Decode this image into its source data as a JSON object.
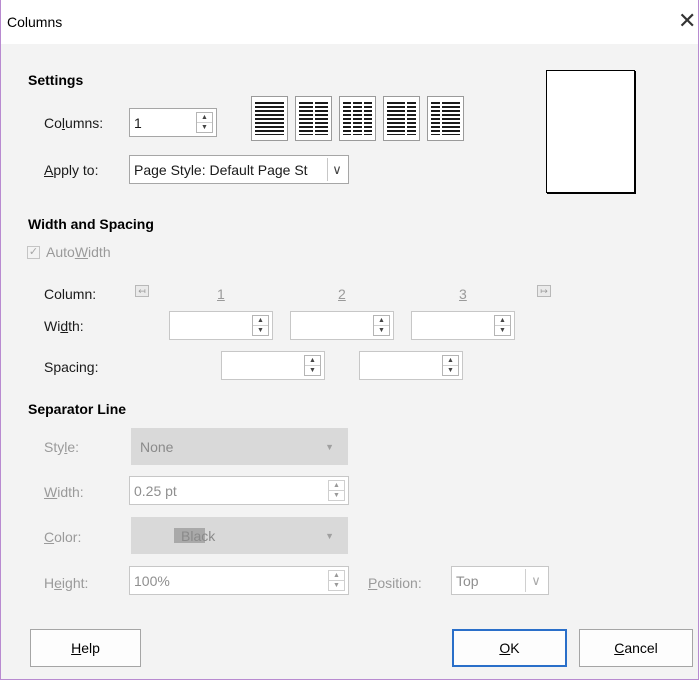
{
  "dialog": {
    "title": "Columns",
    "close_glyph": "✕"
  },
  "settings": {
    "heading": "Settings",
    "columns_label_pre": "Co",
    "columns_label_ul": "l",
    "columns_label_post": "umns:",
    "columns_value": "1",
    "apply_label_ul": "A",
    "apply_label_post": "pply to:",
    "apply_value": "Page Style: Default Page St",
    "presets": [
      "1 column",
      "2 columns equal",
      "3 columns equal",
      "2 columns left larger",
      "2 columns right larger"
    ]
  },
  "width_spacing": {
    "heading": "Width and Spacing",
    "autowidth_pre": "Auto",
    "autowidth_ul": "W",
    "autowidth_post": "idth",
    "autowidth_checked": true,
    "column_label": "Column:",
    "col1": "1",
    "col2": "2",
    "col3": "3",
    "width_label_pre": "Wi",
    "width_label_ul": "d",
    "width_label_post": "th:",
    "spacing_label": "Spacing:"
  },
  "separator": {
    "heading": "Separator Line",
    "style_label_pre": "Sty",
    "style_label_ul": "l",
    "style_label_post": "e:",
    "style_value": "None",
    "width_label_ul": "W",
    "width_label_post": "idth:",
    "width_value": "0.25 pt",
    "color_label_ul": "C",
    "color_label_post": "olor:",
    "color_value": "Black",
    "color_swatch": "#a9a9a9",
    "height_label_pre": "H",
    "height_label_ul": "e",
    "height_label_post": "ight:",
    "height_value": "100%",
    "position_label_ul": "P",
    "position_label_post": "osition:",
    "position_value": "Top"
  },
  "buttons": {
    "help_ul": "H",
    "help_post": "elp",
    "ok_ul": "O",
    "ok_post": "K",
    "cancel_ul": "C",
    "cancel_post": "ancel"
  },
  "icons": {
    "spin_up": "▲",
    "spin_down": "▼",
    "dropdown_arrow": "▼",
    "chevron_down": "∨",
    "nav_left": "↤",
    "nav_right": "↦",
    "check": "✓"
  },
  "colors": {
    "accent": "#2a6fc9",
    "dialog_border": "#b88ad0"
  }
}
